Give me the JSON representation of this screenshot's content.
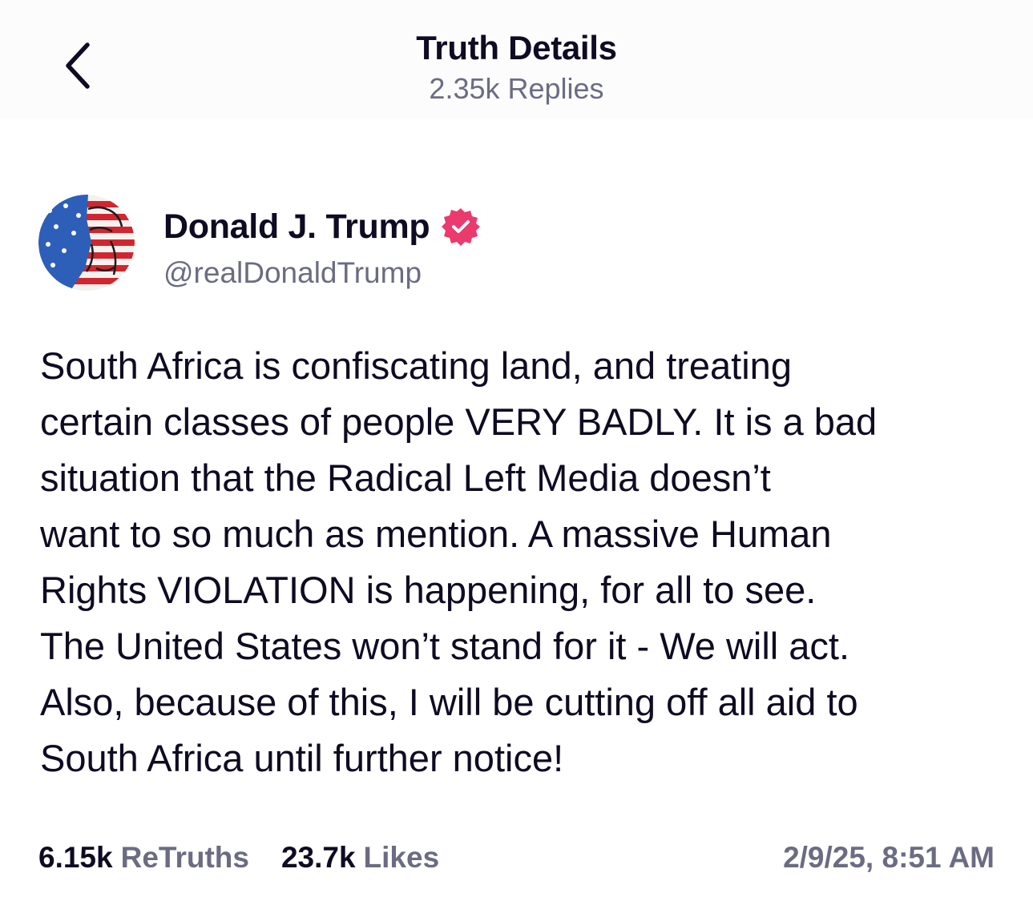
{
  "header": {
    "title": "Truth Details",
    "subtitle": "2.35k Replies",
    "back_icon": "chevron-left-icon"
  },
  "post": {
    "author": {
      "name": "Donald J. Trump",
      "handle": "@realDonaldTrump",
      "verified_icon": "verified-badge-icon",
      "verified_color": "#ea3a6e"
    },
    "body": "South Africa is confiscating land, and treating\ncertain classes of people VERY BADLY. It is a bad\nsituation that the Radical Left Media doesn’t\nwant to so much as mention. A massive Human\nRights VIOLATION is happening, for all to see.\nThe United States won’t stand for it - We will act.\nAlso, because of this, I will be cutting off all aid to\nSouth Africa until further notice!",
    "stats": {
      "retruths_count": "6.15k",
      "retruths_label": "ReTruths",
      "likes_count": "23.7k",
      "likes_label": "Likes"
    },
    "timestamp": "2/9/25, 8:51 AM"
  },
  "colors": {
    "text_primary": "#0e0b22",
    "text_secondary": "#6b6c83",
    "accent": "#ea3a6e"
  }
}
